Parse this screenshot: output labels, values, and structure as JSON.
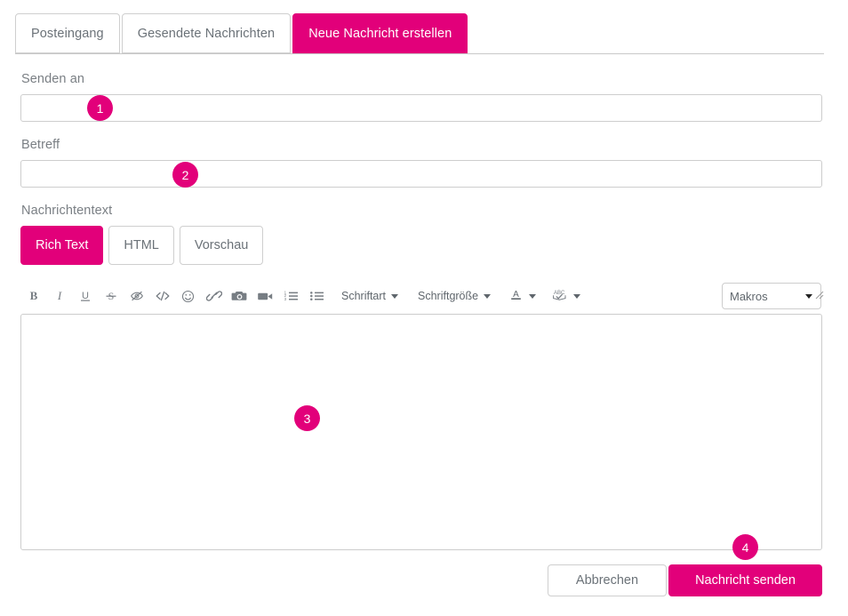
{
  "tabs": [
    {
      "label": "Posteingang",
      "active": false
    },
    {
      "label": "Gesendete Nachrichten",
      "active": false
    },
    {
      "label": "Neue Nachricht erstellen",
      "active": true
    }
  ],
  "form": {
    "to": {
      "label": "Senden an",
      "value": "",
      "placeholder": ""
    },
    "subject": {
      "label": "Betreff",
      "value": "",
      "placeholder": ""
    },
    "body": {
      "label": "Nachrichtentext",
      "value": "",
      "placeholder": ""
    }
  },
  "editor_modes": [
    {
      "label": "Rich Text",
      "active": true
    },
    {
      "label": "HTML",
      "active": false
    },
    {
      "label": "Vorschau",
      "active": false
    }
  ],
  "toolbar": {
    "bold": "bold-icon",
    "italic": "italic-icon",
    "underline": "underline-icon",
    "strikethrough": "strikethrough-icon",
    "hidden_text": "eye-slash-icon",
    "source_code": "code-icon",
    "emoji": "emoji-icon",
    "link": "link-icon",
    "image": "camera-icon",
    "video": "video-camera-icon",
    "ordered_list": "ordered-list-icon",
    "unordered_list": "unordered-list-icon",
    "font_family_label": "Schriftart",
    "font_size_label": "Schriftgröße",
    "font_color": "font-color-a-icon",
    "spellcheck": "spellcheck-abc-icon",
    "macros": {
      "label": "Makros",
      "selected": "Makros",
      "options": [
        "Makros"
      ]
    }
  },
  "footer": {
    "cancel_label": "Abbrechen",
    "send_label": "Nachricht senden"
  },
  "badges": [
    {
      "number": "1"
    },
    {
      "number": "2"
    },
    {
      "number": "3"
    },
    {
      "number": "4"
    }
  ],
  "colors": {
    "accent": "#e2007a",
    "border": "#cdcdcd",
    "text": "#6b7278",
    "label": "#7a7f84",
    "icon": "#777d83"
  }
}
